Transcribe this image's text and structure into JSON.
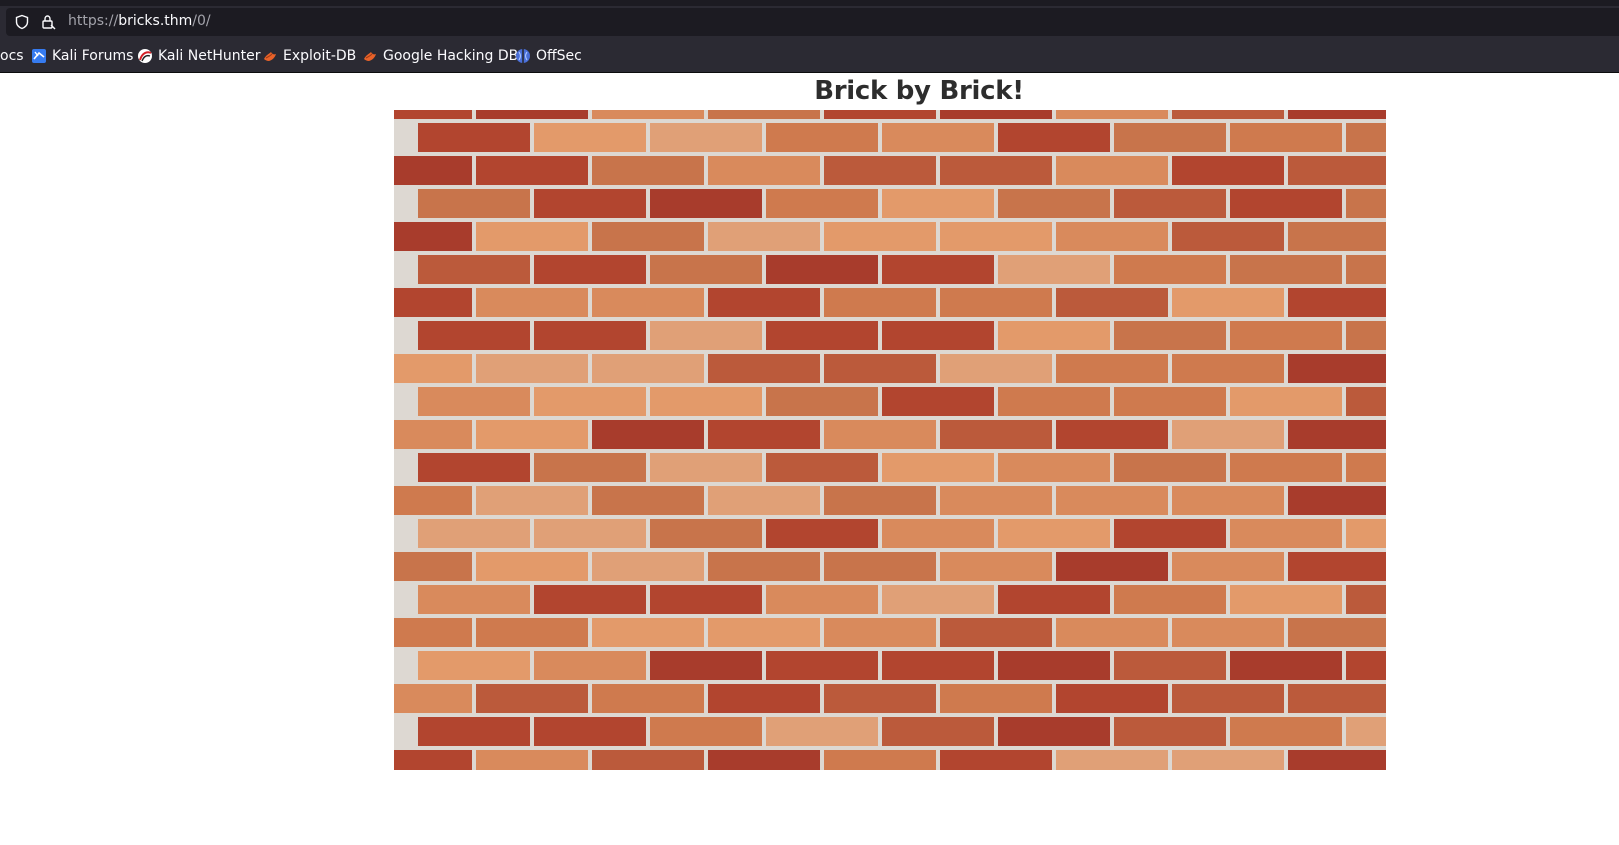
{
  "browser": {
    "url": {
      "scheme": "https://",
      "host": "bricks.thm",
      "path": "/0/"
    },
    "bookmarks": [
      {
        "label": "ocs",
        "icon": "docs-icon"
      },
      {
        "label": "Kali Forums",
        "icon": "kali-forums-icon"
      },
      {
        "label": "Kali NetHunter",
        "icon": "kali-nethunter-icon"
      },
      {
        "label": "Exploit-DB",
        "icon": "exploit-db-icon"
      },
      {
        "label": "Google Hacking DB",
        "icon": "google-hacking-db-icon"
      },
      {
        "label": "OffSec",
        "icon": "offsec-icon"
      }
    ]
  },
  "page": {
    "title": "Brick by Brick!",
    "image": "brick-wall-image"
  },
  "colors": {
    "chrome_dark": "#1c1b22",
    "chrome": "#2b2a33",
    "mortar": "#ddd8d2",
    "brick_tones": [
      "#d98a5c",
      "#c8744b",
      "#e39a6a",
      "#b2452f",
      "#a83c2c",
      "#cf7a4e",
      "#e0a077",
      "#bb5a3b"
    ]
  }
}
